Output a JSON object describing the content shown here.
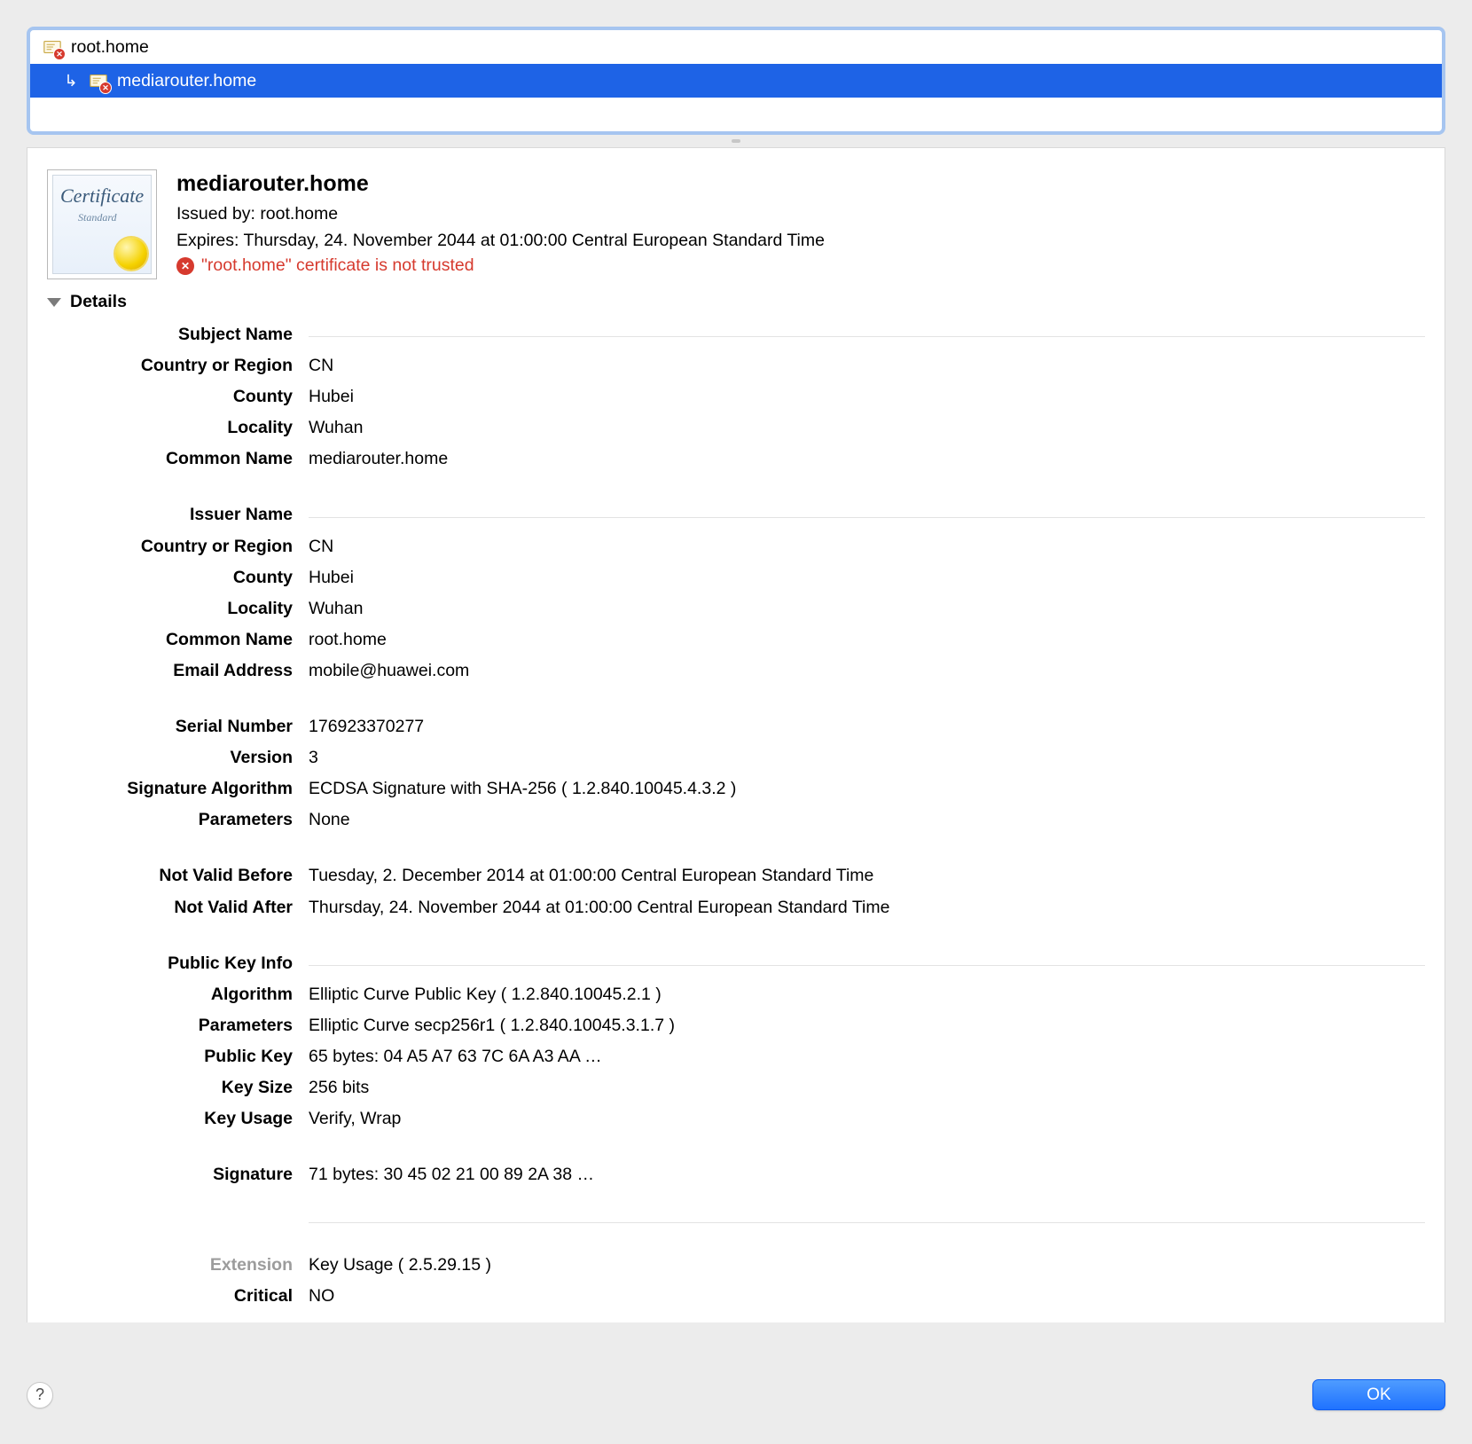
{
  "tree": {
    "root": {
      "label": "root.home"
    },
    "child": {
      "label": "mediarouter.home"
    }
  },
  "header": {
    "title": "mediarouter.home",
    "issued_by_label": "Issued by: ",
    "issued_by_value": "root.home",
    "expires_label": "Expires: ",
    "expires_value": "Thursday, 24. November 2044 at 01:00:00 Central European Standard Time",
    "trust_error": "\"root.home\" certificate is not trusted"
  },
  "details": {
    "title": "Details",
    "subject_name": {
      "heading": "Subject Name",
      "country_label": "Country or Region",
      "country_value": "CN",
      "county_label": "County",
      "county_value": "Hubei",
      "locality_label": "Locality",
      "locality_value": "Wuhan",
      "common_label": "Common Name",
      "common_value": "mediarouter.home"
    },
    "issuer_name": {
      "heading": "Issuer Name",
      "country_label": "Country or Region",
      "country_value": "CN",
      "county_label": "County",
      "county_value": "Hubei",
      "locality_label": "Locality",
      "locality_value": "Wuhan",
      "common_label": "Common Name",
      "common_value": "root.home",
      "email_label": "Email Address",
      "email_value": "mobile@huawei.com"
    },
    "serial": {
      "serial_label": "Serial Number",
      "serial_value": "176923370277",
      "version_label": "Version",
      "version_value": "3",
      "sigalg_label": "Signature Algorithm",
      "sigalg_value": "ECDSA Signature with SHA-256 ( 1.2.840.10045.4.3.2 )",
      "params_label": "Parameters",
      "params_value": "None"
    },
    "validity": {
      "nvb_label": "Not Valid Before",
      "nvb_value": "Tuesday, 2. December 2014 at 01:00:00 Central European Standard Time",
      "nva_label": "Not Valid After",
      "nva_value": "Thursday, 24. November 2044 at 01:00:00 Central European Standard Time"
    },
    "pubkey": {
      "heading": "Public Key Info",
      "alg_label": "Algorithm",
      "alg_value": "Elliptic Curve Public Key ( 1.2.840.10045.2.1 )",
      "params_label": "Parameters",
      "params_value": "Elliptic Curve secp256r1 ( 1.2.840.10045.3.1.7 )",
      "pk_label": "Public Key",
      "pk_value": "65 bytes: 04 A5 A7 63 7C 6A A3 AA …",
      "size_label": "Key Size",
      "size_value": "256 bits",
      "usage_label": "Key Usage",
      "usage_value": "Verify, Wrap"
    },
    "signature": {
      "label": "Signature",
      "value": "71 bytes: 30 45 02 21 00 89 2A 38 …"
    },
    "extension": {
      "ext_label": "Extension",
      "ext_value": "Key Usage ( 2.5.29.15 )",
      "crit_label": "Critical",
      "crit_value": "NO"
    }
  },
  "footer": {
    "help_tooltip": "Help",
    "ok_label": "OK"
  }
}
